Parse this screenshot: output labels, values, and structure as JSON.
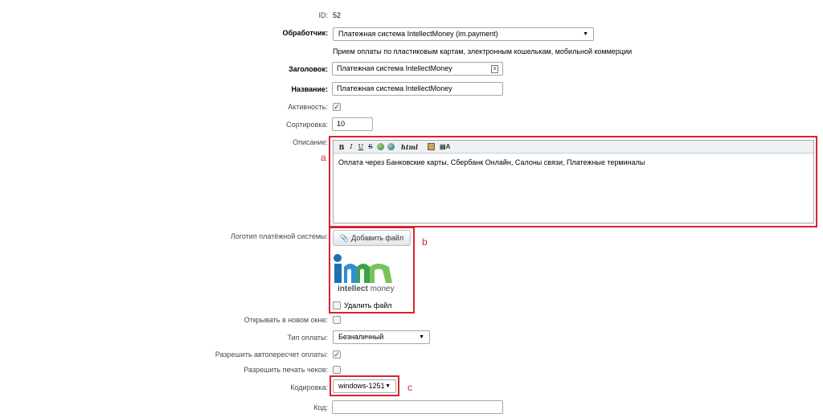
{
  "id": {
    "label": "ID:",
    "value": "52"
  },
  "handler": {
    "label": "Обработчик:",
    "value": "Платежная система IntellectMoney (im.payment)",
    "description": "Прием оплаты по пластиковым картам, электронным кошелькам, мобильной коммерции"
  },
  "header": {
    "label": "Заголовок:",
    "value": "Платежная система IntellectMoney",
    "icon": "text-field-icon"
  },
  "name": {
    "label": "Название:",
    "value": "Платежная система IntellectMoney"
  },
  "active": {
    "label": "Активность:",
    "checked": true
  },
  "sort": {
    "label": "Сортировка:",
    "value": "10"
  },
  "description": {
    "label": "Описание:",
    "toolbar": {
      "bold": "B",
      "italic": "I",
      "underline": "U",
      "strike": "S",
      "html": "html"
    },
    "text": "Оплата через Банковские карты, Сбербанк Онлайн, Салоны связи, Платежные терминалы"
  },
  "logo": {
    "label": "Логотип платёжной системы:",
    "add_button": "Добавить файл",
    "logo_text_bold": "intellect",
    "logo_text_light": " money",
    "delete_label": "Удалить файл"
  },
  "new_window": {
    "label": "Открывать в новом окне:",
    "checked": false
  },
  "payment_type": {
    "label": "Тип оплаты:",
    "value": "Безналичный"
  },
  "allow_recalc": {
    "label": "Разрешить автопересчет оплаты:",
    "checked": true
  },
  "allow_print": {
    "label": "Разрешить печать чеков:",
    "checked": false
  },
  "encoding": {
    "label": "Кодировка:",
    "value": "windows-1251"
  },
  "code": {
    "label": "Код:",
    "value": ""
  },
  "markers": {
    "a": "a",
    "b": "b",
    "c": "c"
  },
  "colors": {
    "highlight": "#d9242f",
    "logo_blue": "#1f6fb5",
    "logo_green": "#3aa34a"
  }
}
